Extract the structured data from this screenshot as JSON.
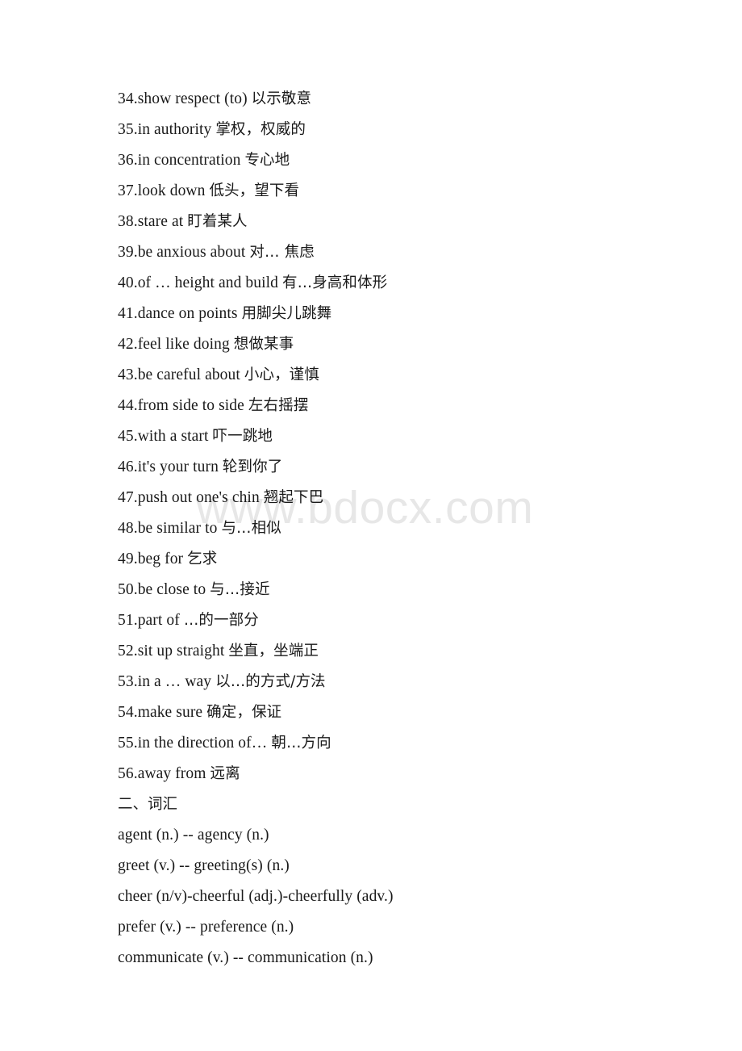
{
  "document": {
    "background_color": "#ffffff",
    "text_color": "#1a1a1a"
  },
  "watermark": {
    "text": "www.bdocx.com",
    "color": "#e7e7e7"
  },
  "phrases": [
    {
      "number": "34.",
      "english": "show respect (to) ",
      "chinese": "以示敬意"
    },
    {
      "number": "35.",
      "english": "in authority  ",
      "chinese": "掌权，权威的"
    },
    {
      "number": "36.",
      "english": "in concentration ",
      "chinese": "专心地"
    },
    {
      "number": "37.",
      "english": "look down ",
      "chinese": "低头，望下看"
    },
    {
      "number": "38.",
      "english": "stare at ",
      "chinese": "盯着某人"
    },
    {
      "number": "39.",
      "english": "be anxious about ",
      "chinese": "对… 焦虑"
    },
    {
      "number": "40.",
      "english": "of … height and build ",
      "chinese": "有…身高和体形"
    },
    {
      "number": "41.",
      "english": "dance on points  ",
      "chinese": "用脚尖儿跳舞"
    },
    {
      "number": "42.",
      "english": "feel like doing   ",
      "chinese": "想做某事"
    },
    {
      "number": "43.",
      "english": "be careful about  ",
      "chinese": "小心，谨慎"
    },
    {
      "number": "44.",
      "english": "from side to side  ",
      "chinese": "左右摇摆"
    },
    {
      "number": "45.",
      "english": "with a start   ",
      "chinese": "吓一跳地"
    },
    {
      "number": "46.",
      "english": "it's your turn   ",
      "chinese": "轮到你了"
    },
    {
      "number": "47.",
      "english": "push out one's chin ",
      "chinese": "翘起下巴"
    },
    {
      "number": "48.",
      "english": "be similar to ",
      "chinese": "与…相似"
    },
    {
      "number": "49.",
      "english": "beg for  ",
      "chinese": "乞求"
    },
    {
      "number": "50.",
      "english": "be close to ",
      "chinese": "与…接近"
    },
    {
      "number": "51.",
      "english": "part of  ",
      "chinese": "…的一部分"
    },
    {
      "number": "52.",
      "english": "sit up straight ",
      "chinese": "坐直，坐端正"
    },
    {
      "number": "53.",
      "english": "in a … way ",
      "chinese": "以…的方式/方法"
    },
    {
      "number": "54.",
      "english": "make sure ",
      "chinese": "确定，保证"
    },
    {
      "number": "55.",
      "english": "in the direction of… ",
      "chinese": "朝…方向"
    },
    {
      "number": "56.",
      "english": "away from  ",
      "chinese": "远离"
    }
  ],
  "section": {
    "heading": "二、词汇"
  },
  "vocabulary": [
    {
      "text": "agent (n.) -- agency (n.)"
    },
    {
      "text": "greet (v.) -- greeting(s) (n.)"
    },
    {
      "text": "cheer (n/v)-cheerful (adj.)-cheerfully (adv.)"
    },
    {
      "text": "prefer (v.) -- preference (n.)"
    },
    {
      "text": "communicate (v.) -- communication (n.)"
    }
  ]
}
